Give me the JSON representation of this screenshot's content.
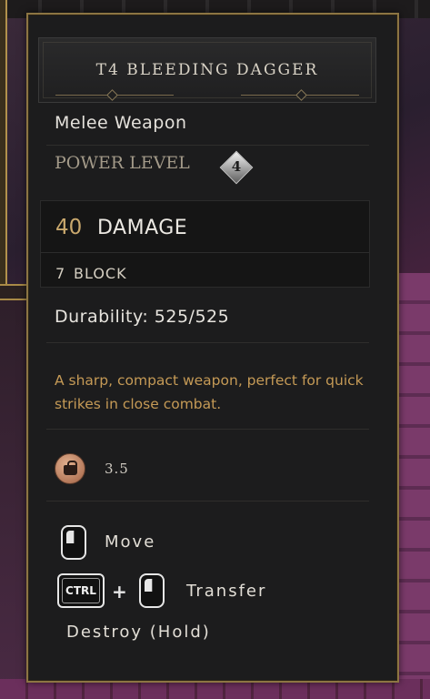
{
  "item": {
    "title": "T4 BLEEDING DAGGER",
    "weapon_type": "Melee Weapon",
    "power_level_label": "POWER LEVEL",
    "power_level_value": "4"
  },
  "stats": {
    "damage_value": "40",
    "damage_label": "DAMAGE",
    "block_value": "7",
    "block_label": "BLOCK"
  },
  "durability": "Durability: 525/525",
  "description": "A sharp, compact weapon, perfect for quick strikes in close combat.",
  "weight": {
    "icon": "weight-icon",
    "value": "3.5"
  },
  "controls": {
    "move_label": "Move",
    "ctrl_key": "CTRL",
    "plus": "+",
    "transfer_label": "Transfer",
    "destroy_label": "Destroy (Hold)"
  },
  "colors": {
    "panel_border": "#8c7543",
    "damage_accent": "#c9a86d",
    "description_text": "#c59a56"
  }
}
